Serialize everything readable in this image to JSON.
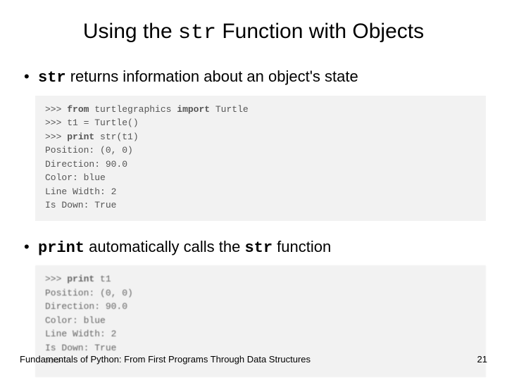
{
  "title": {
    "pre": "Using the ",
    "code": "str",
    "post": " Function with Objects"
  },
  "bullet1": {
    "code": "str",
    "rest": " returns information about an object's state"
  },
  "code1": {
    "line1_prompt": ">>> ",
    "line1_kw1": "from",
    "line1_mid": " turtlegraphics ",
    "line1_kw2": "import",
    "line1_end": " Turtle",
    "line2": ">>> t1 = Turtle()",
    "line3_prompt": ">>> ",
    "line3_kw": "print",
    "line3_rest": " str(t1)",
    "line4": "Position: (0, 0)",
    "line5": "Direction: 90.0",
    "line6": "Color: blue",
    "line7": "Line Width: 2",
    "line8": "Is Down: True"
  },
  "bullet2": {
    "code1": "print",
    "mid": " automatically calls the ",
    "code2": "str",
    "rest": " function"
  },
  "code2": {
    "line1_prompt": ">>> ",
    "line1_kw": "print",
    "line1_rest": " t1",
    "line2": "Position: (0, 0)",
    "line3": "Direction: 90.0",
    "line4": "Color: blue",
    "line5": "Line Width: 2",
    "line6": "Is Down: True",
    "line7": ">>>"
  },
  "footer": {
    "text": "Fundamentals of Python: From First Programs Through Data Structures",
    "page": "21"
  }
}
